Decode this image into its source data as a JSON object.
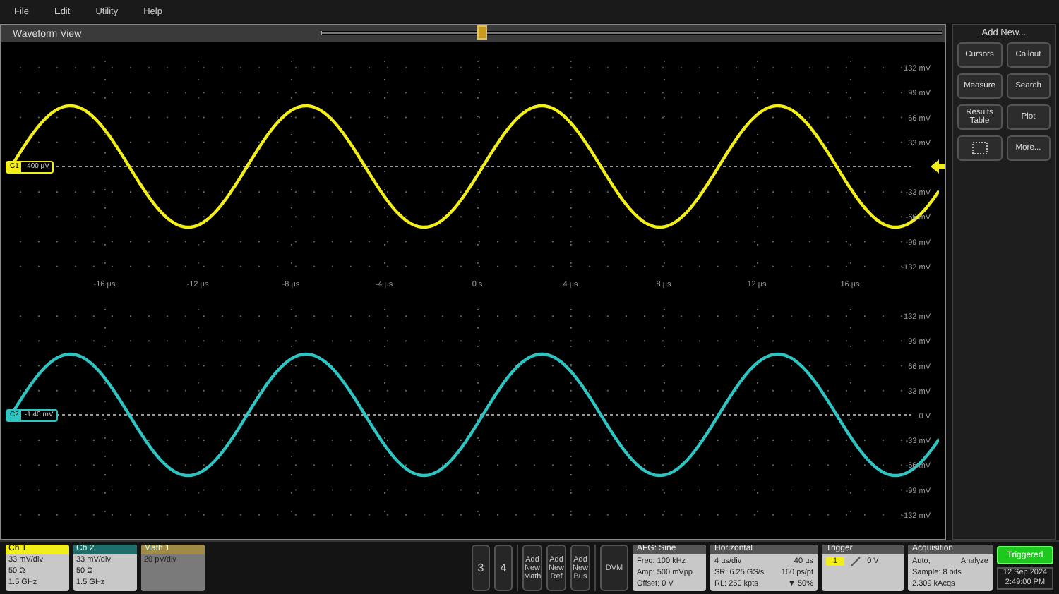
{
  "menu": [
    "File",
    "Edit",
    "Utility",
    "Help"
  ],
  "waveform_view": {
    "title": "Waveform View",
    "position": {
      "level": 0.25
    },
    "time_labels": [
      "-16 µs",
      "-12 µs",
      "-8 µs",
      "-4 µs",
      "0 s",
      "4 µs",
      "8 µs",
      "12 µs",
      "16 µs"
    ],
    "panes": [
      {
        "channel": "C1",
        "offset": "-400 µV",
        "color": "#f2ee1a",
        "trigger_marker": true,
        "y_labels": [
          "132 mV",
          "99 mV",
          "66 mV",
          "33 mV",
          "-33 mV",
          "-66 mV",
          "-99 mV",
          "-132 mV"
        ]
      },
      {
        "channel": "C2",
        "offset": "-1.40 mV",
        "color": "#2ec4c2",
        "y_labels": [
          "132 mV",
          "99 mV",
          "66 mV",
          "33 mV",
          "0 V",
          "-33 mV",
          "-66 mV",
          "-99 mV",
          "-132 mV"
        ]
      }
    ]
  },
  "add_new": {
    "title": "Add New...",
    "buttons": [
      {
        "kind": "text",
        "label": "Cursors"
      },
      {
        "kind": "text",
        "label": "Callout"
      },
      {
        "kind": "text",
        "label": "Measure"
      },
      {
        "kind": "text",
        "label": "Search"
      },
      {
        "kind": "text",
        "label": "Results Table"
      },
      {
        "kind": "text",
        "label": "Plot"
      },
      {
        "kind": "icon"
      },
      {
        "kind": "text",
        "label": "More..."
      }
    ]
  },
  "channel_badges": [
    {
      "name": "Ch 1",
      "color": "#f2ee1a",
      "lines": [
        "33 mV/div",
        "50 Ω",
        "1.5 GHz"
      ]
    },
    {
      "name": "Ch 2",
      "color": "#1f6e6c",
      "lines": [
        "33 mV/div",
        "50 Ω",
        "1.5 GHz"
      ]
    },
    {
      "name": "Math 1",
      "color": "#a08a48",
      "lines": [
        "20 pV/div"
      ]
    }
  ],
  "channel_buttons": [
    "3",
    "4"
  ],
  "add_buttons": [
    "Add New Math",
    "Add New Ref",
    "Add New Bus"
  ],
  "dvm_button": "DVM",
  "afg": {
    "title": "AFG: Sine",
    "rows": [
      [
        "Freq: 100 kHz"
      ],
      [
        "Amp: 500 mVpp"
      ],
      [
        "Offset: 0 V"
      ]
    ]
  },
  "horizontal": {
    "title": "Horizontal",
    "rows": [
      [
        "4 µs/div",
        "40 µs"
      ],
      [
        "SR: 6.25 GS/s",
        "160 ps/pt"
      ],
      [
        "RL: 250 kpts",
        "▼ 50%"
      ]
    ]
  },
  "trigger": {
    "title": "Trigger",
    "source": "1",
    "level": "0 V"
  },
  "acquisition": {
    "title": "Acquisition",
    "rows": [
      [
        "Auto,",
        "Analyze"
      ],
      [
        "Sample: 8 bits"
      ],
      [
        "2.309 kAcqs"
      ]
    ]
  },
  "status": {
    "label": "Triggered",
    "date": "12 Sep 2024",
    "time": "2:49:00 PM"
  }
}
